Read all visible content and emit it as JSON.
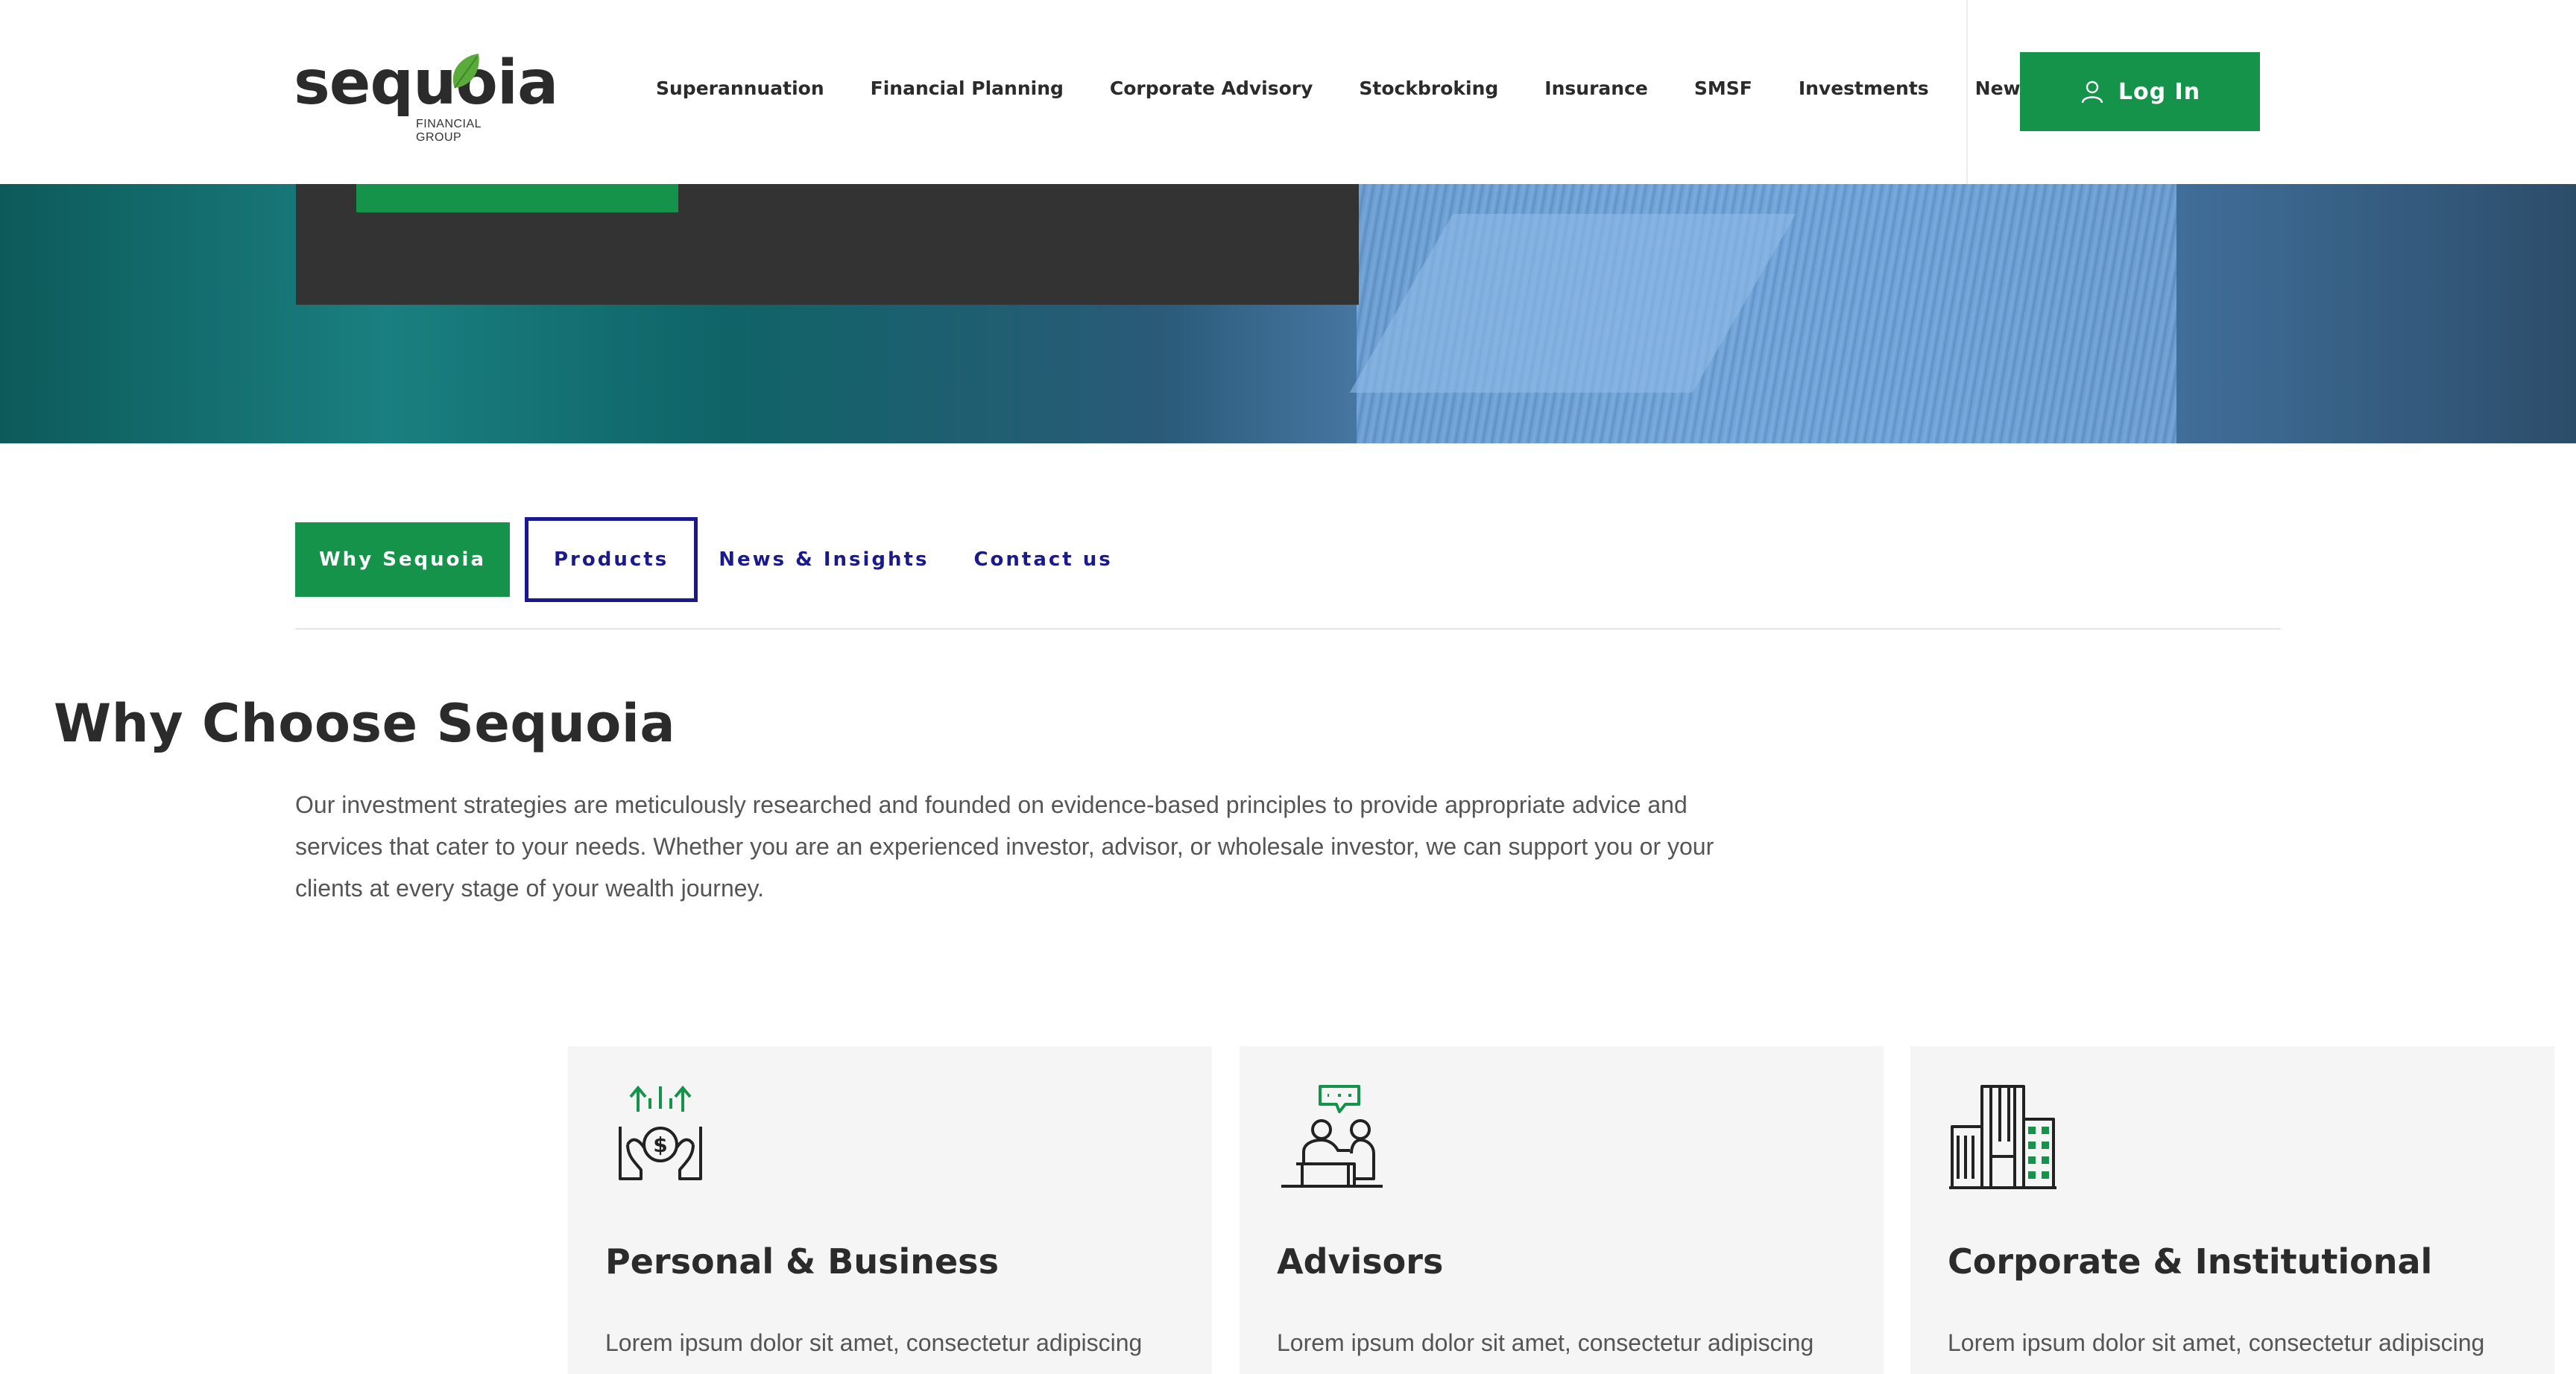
{
  "brand": {
    "name": "sequoia",
    "tagline": "FINANCIAL GROUP",
    "accent_green": "#16934a",
    "nav_blue": "#1a1a8c"
  },
  "nav": {
    "items": [
      {
        "label": "Superannuation"
      },
      {
        "label": "Financial Planning"
      },
      {
        "label": "Corporate Advisory"
      },
      {
        "label": "Stockbroking"
      },
      {
        "label": "Insurance"
      },
      {
        "label": "SMSF"
      },
      {
        "label": "Investments"
      },
      {
        "label": "News"
      }
    ],
    "login_label": "Log In",
    "login_icon": "user-icon"
  },
  "tabs": [
    {
      "label": "Why Sequoia",
      "state": "active"
    },
    {
      "label": "Products",
      "state": "focused"
    },
    {
      "label": "News & Insights",
      "state": "default"
    },
    {
      "label": "Contact us",
      "state": "default"
    }
  ],
  "section": {
    "title": "Why Choose Sequoia",
    "intro": "Our investment strategies are meticulously researched and founded on evidence-based principles to provide appropriate advice and services that cater to your needs. Whether you are an experienced investor, advisor, or wholesale investor, we can support you or your clients at every stage of your wealth journey."
  },
  "cards": [
    {
      "title": "Personal & Business",
      "text": "Lorem ipsum dolor sit amet, consectetur adipiscing",
      "icon": "money-hands-icon"
    },
    {
      "title": "Advisors",
      "text": "Lorem ipsum dolor sit amet, consectetur adipiscing",
      "icon": "advisor-meeting-icon"
    },
    {
      "title": "Corporate & Institutional",
      "text": "Lorem ipsum dolor sit amet, consectetur adipiscing",
      "icon": "office-buildings-icon"
    }
  ]
}
